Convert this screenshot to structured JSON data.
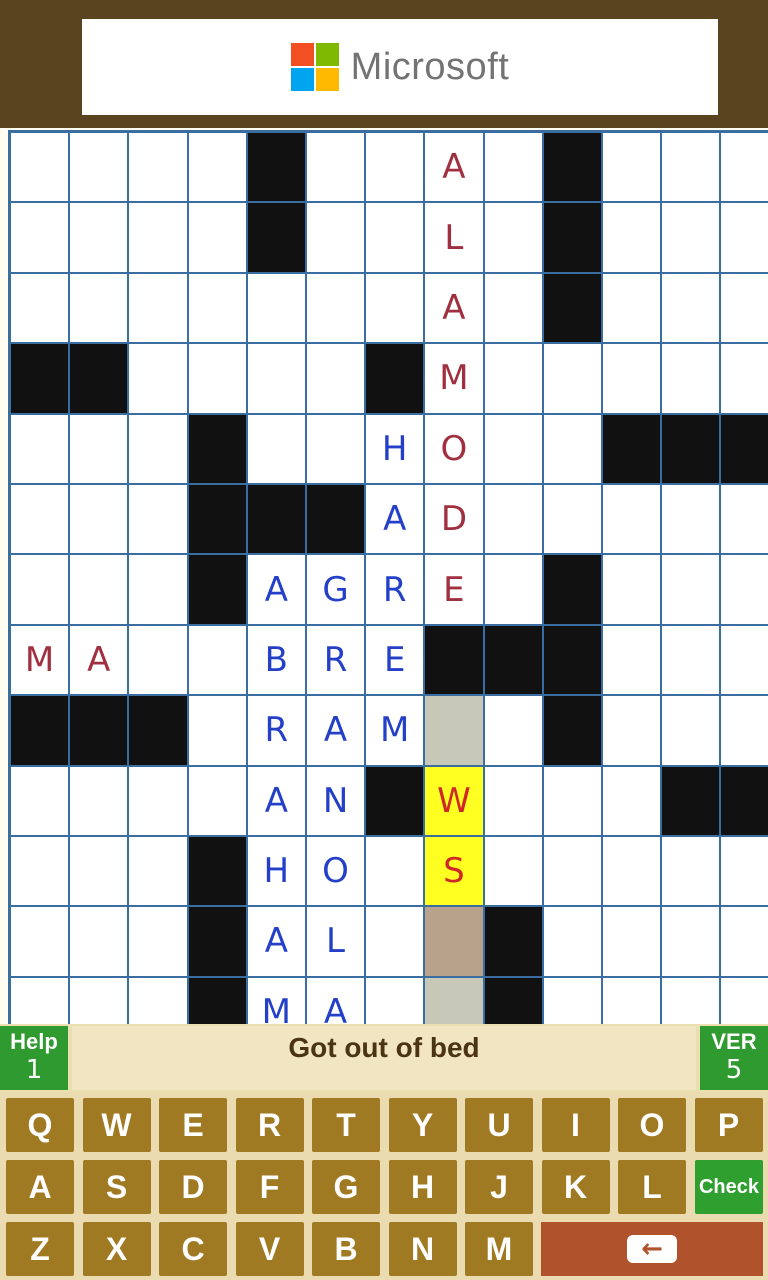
{
  "ad": {
    "brand": "Microsoft",
    "logo_colors": [
      "#f25022",
      "#7fba00",
      "#00a4ef",
      "#ffb900"
    ]
  },
  "grid": {
    "rows": [
      "....#..A.#...",
      "....#..L.#...",
      ".......A.#...",
      "##....#M.....",
      "...#..HO..###",
      "...###AD.....",
      "...#AGRE.#...",
      "MA..BRE###...",
      "###.RAM!.#...",
      "....AN#W...##",
      "...#HO.S.....",
      "...#AL.?#....",
      "...#MA.!#...."
    ],
    "red_cells": [
      "0-7",
      "1-7",
      "2-7",
      "3-7",
      "4-7",
      "5-7",
      "6-7",
      "7-0",
      "7-1",
      "9-7",
      "10-7"
    ],
    "selected_cells": [
      "9-7",
      "10-7"
    ],
    "highlight_light_cells": [
      "8-7",
      "12-7"
    ],
    "highlight_dark_cells": [
      "11-7"
    ]
  },
  "clue": {
    "help_label": "Help",
    "help_count": "1",
    "text": "Got out of bed",
    "direction_label": "VER",
    "number": "5"
  },
  "keyboard": {
    "rows": [
      [
        "Q",
        "W",
        "E",
        "R",
        "T",
        "Y",
        "U",
        "I",
        "O",
        "P"
      ],
      [
        "A",
        "S",
        "D",
        "F",
        "G",
        "H",
        "J",
        "K",
        "L"
      ],
      [
        "Z",
        "X",
        "C",
        "V",
        "B",
        "N",
        "M"
      ]
    ],
    "check_label": "Check",
    "backspace_icon": "arrow-left-icon",
    "backspace_glyph": "←"
  },
  "colors": {
    "letter_blue": "#2440c8",
    "letter_red": "#a03040",
    "selected": "#ffff22",
    "key_brown": "#a07a22",
    "green": "#2f9a2f"
  }
}
